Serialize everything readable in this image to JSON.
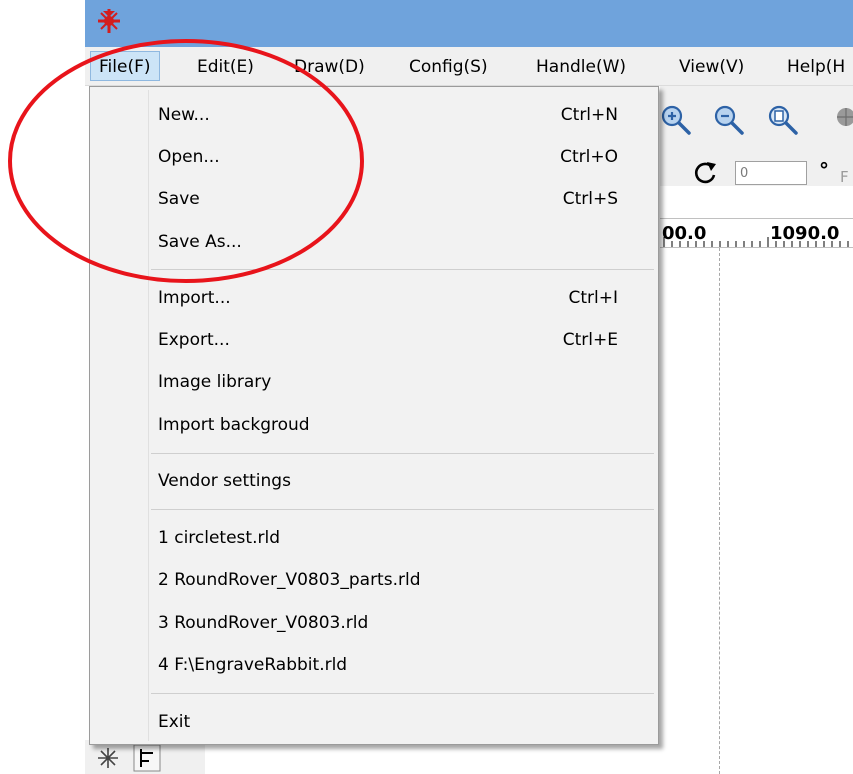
{
  "menubar": {
    "items": [
      {
        "label": "File(F)",
        "active": true
      },
      {
        "label": "Edit(E)"
      },
      {
        "label": "Draw(D)"
      },
      {
        "label": "Config(S)"
      },
      {
        "label": "Handle(W)"
      },
      {
        "label": "View(V)"
      },
      {
        "label": "Help(H"
      }
    ]
  },
  "file_menu": {
    "items": [
      {
        "label": "New...",
        "shortcut": "Ctrl+N"
      },
      {
        "label": "Open...",
        "shortcut": "Ctrl+O"
      },
      {
        "label": "Save",
        "shortcut": "Ctrl+S"
      },
      {
        "label": "Save As...",
        "shortcut": ""
      },
      {
        "label": "Import...",
        "shortcut": "Ctrl+I"
      },
      {
        "label": "Export...",
        "shortcut": "Ctrl+E"
      },
      {
        "label": "Image library",
        "shortcut": ""
      },
      {
        "label": "Import backgroud",
        "shortcut": ""
      },
      {
        "label": "Vendor settings",
        "shortcut": ""
      },
      {
        "label": "1 circletest.rld",
        "shortcut": ""
      },
      {
        "label": "2 RoundRover_V0803_parts.rld",
        "shortcut": ""
      },
      {
        "label": "3 RoundRover_V0803.rld",
        "shortcut": ""
      },
      {
        "label": "4 F:\\EngraveRabbit.rld",
        "shortcut": ""
      },
      {
        "label": "Exit",
        "shortcut": ""
      }
    ]
  },
  "toolbar": {
    "angle_value": "0",
    "degree_symbol": "°",
    "cut_label": "F"
  },
  "ruler": {
    "labels": [
      "00.0",
      "1090.0"
    ]
  },
  "colors": {
    "title_bar": "#6fa3dc",
    "annotation_circle": "#e8141b",
    "menu_highlight": "#cce4f7"
  },
  "icons": [
    "app-logo-icon",
    "zoom-in-icon",
    "zoom-out-icon",
    "zoom-page-icon",
    "globe-icon",
    "rotate-icon",
    "asterisk-tool-icon",
    "align-tool-icon"
  ]
}
